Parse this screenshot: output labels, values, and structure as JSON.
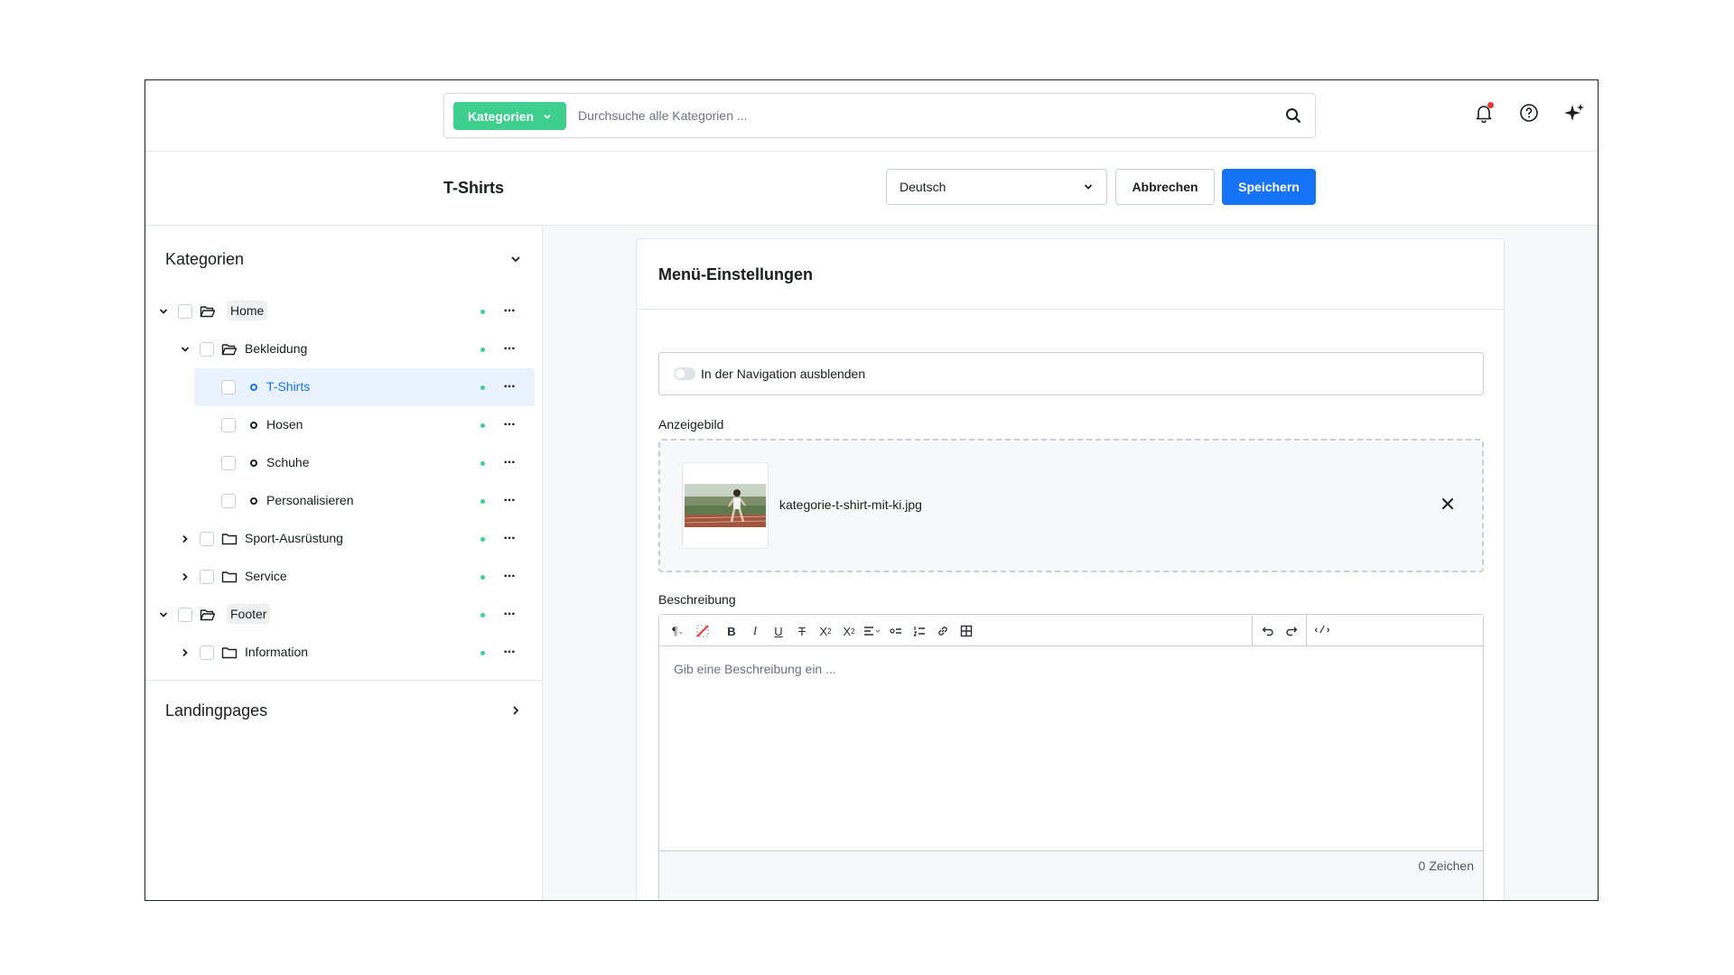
{
  "topbar": {
    "category_filter": "Kategorien",
    "search_placeholder": "Durchsuche alle Kategorien ...",
    "icons": [
      "search-icon",
      "bell-icon",
      "help-icon",
      "sparkle-icon"
    ],
    "notification_dot_color": "#e53935"
  },
  "page": {
    "title": "T-Shirts",
    "language": "Deutsch",
    "cancel_label": "Abbrechen",
    "save_label": "Speichern"
  },
  "sidebar": {
    "title": "Kategorien",
    "tree": [
      {
        "label": "Home",
        "level": 0,
        "expanded": true,
        "type": "folder-open"
      },
      {
        "label": "Bekleidung",
        "level": 1,
        "expanded": true,
        "type": "folder-open"
      },
      {
        "label": "T-Shirts",
        "level": 2,
        "type": "leaf",
        "selected": true
      },
      {
        "label": "Hosen",
        "level": 2,
        "type": "leaf"
      },
      {
        "label": "Schuhe",
        "level": 2,
        "type": "leaf"
      },
      {
        "label": "Personalisieren",
        "level": 2,
        "type": "leaf"
      },
      {
        "label": "Sport-Ausrüstung",
        "level": 1,
        "expanded": false,
        "type": "folder"
      },
      {
        "label": "Service",
        "level": 1,
        "expanded": false,
        "type": "folder"
      },
      {
        "label": "Footer",
        "level": 0,
        "expanded": true,
        "type": "folder-open"
      },
      {
        "label": "Information",
        "level": 1,
        "expanded": false,
        "type": "folder"
      }
    ],
    "landingpages_title": "Landingpages"
  },
  "main": {
    "section_title": "Menü-Einstellungen",
    "hide_in_nav_label": "In der Navigation ausblenden",
    "image_label": "Anzeigebild",
    "image_file": "kategorie-t-shirt-mit-ki.jpg",
    "description_label": "Beschreibung",
    "description_placeholder": "Gib eine Beschreibung ein ...",
    "char_count": "0 Zeichen"
  },
  "colors": {
    "accent": "#1673f5",
    "success": "#3ecf8e",
    "selected_bg": "#eaf2fe"
  }
}
